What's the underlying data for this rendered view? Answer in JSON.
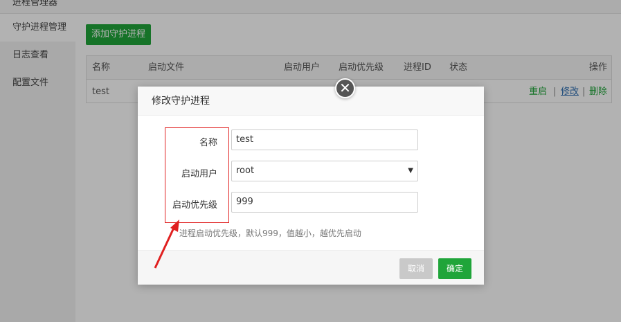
{
  "app": {
    "title": "进程管理器",
    "sidebar": {
      "items": [
        {
          "label": "守护进程管理",
          "active": true
        },
        {
          "label": "日志查看",
          "active": false
        },
        {
          "label": "配置文件",
          "active": false
        }
      ]
    },
    "add_button": "添加守护进程",
    "table": {
      "headers": [
        "名称",
        "启动文件",
        "启动用户",
        "启动优先级",
        "进程ID",
        "状态",
        "操作"
      ],
      "rows": [
        {
          "name": "test",
          "ops": [
            "重启",
            "修改",
            "删除"
          ]
        }
      ]
    }
  },
  "modal": {
    "title": "修改守护进程",
    "close_glyph": "✕",
    "fields": {
      "name_label": "名称",
      "name_value": "test",
      "user_label": "启动用户",
      "user_value": "root",
      "priority_label": "启动优先级",
      "priority_value": "999"
    },
    "hint": "进程启动优先级，默认999，值越小，越优先启动",
    "cancel": "取消",
    "ok": "确定"
  },
  "colors": {
    "accent": "#20a53a",
    "annotation": "#e02020"
  }
}
